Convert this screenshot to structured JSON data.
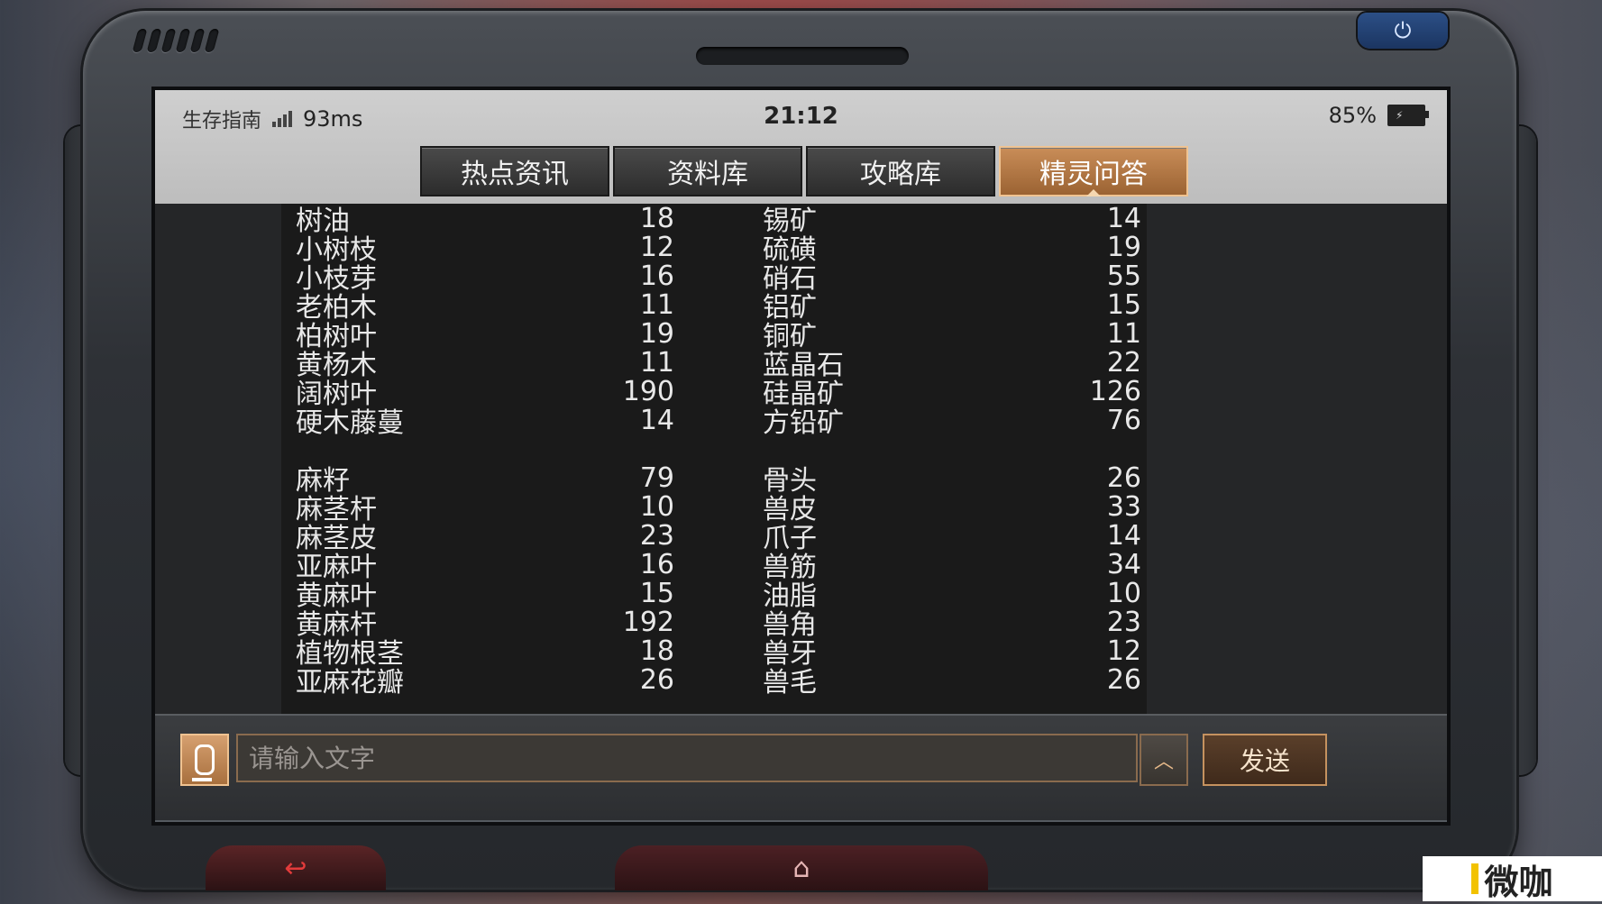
{
  "status": {
    "app_name": "生存指南",
    "ping": "93ms",
    "time": "21:12",
    "battery": "85%"
  },
  "tabs": [
    {
      "label": "热点资讯",
      "active": false
    },
    {
      "label": "资料库",
      "active": false
    },
    {
      "label": "攻略库",
      "active": false
    },
    {
      "label": "精灵问答",
      "active": true
    }
  ],
  "table": {
    "left_group1": [
      {
        "name": "树油",
        "value": "18"
      },
      {
        "name": "小树枝",
        "value": "12"
      },
      {
        "name": "小枝芽",
        "value": "16"
      },
      {
        "name": "老柏木",
        "value": "11"
      },
      {
        "name": "柏树叶",
        "value": "19"
      },
      {
        "name": "黄杨木",
        "value": "11"
      },
      {
        "name": "阔树叶",
        "value": "190"
      },
      {
        "name": "硬木藤蔓",
        "value": "14"
      }
    ],
    "left_group2": [
      {
        "name": "麻籽",
        "value": "79"
      },
      {
        "name": "麻茎杆",
        "value": "10"
      },
      {
        "name": "麻茎皮",
        "value": "23"
      },
      {
        "name": "亚麻叶",
        "value": "16"
      },
      {
        "name": "黄麻叶",
        "value": "15"
      },
      {
        "name": "黄麻杆",
        "value": "192"
      },
      {
        "name": "植物根茎",
        "value": "18"
      },
      {
        "name": "亚麻花瓣",
        "value": "26"
      }
    ],
    "right_group1": [
      {
        "name": "锡矿",
        "value": "14"
      },
      {
        "name": "硫磺",
        "value": "19"
      },
      {
        "name": "硝石",
        "value": "55"
      },
      {
        "name": "铝矿",
        "value": "15"
      },
      {
        "name": "铜矿",
        "value": "11"
      },
      {
        "name": "蓝晶石",
        "value": "22"
      },
      {
        "name": "硅晶矿",
        "value": "126"
      },
      {
        "name": "方铅矿",
        "value": "76"
      }
    ],
    "right_group2": [
      {
        "name": "骨头",
        "value": "26"
      },
      {
        "name": "兽皮",
        "value": "33"
      },
      {
        "name": "爪子",
        "value": "14"
      },
      {
        "name": "兽筋",
        "value": "34"
      },
      {
        "name": "油脂",
        "value": "10"
      },
      {
        "name": "兽角",
        "value": "23"
      },
      {
        "name": "兽牙",
        "value": "12"
      },
      {
        "name": "兽毛",
        "value": "26"
      }
    ]
  },
  "input": {
    "placeholder": "请输入文字",
    "send_label": "发送"
  },
  "icons": {
    "back": "back-arrow-icon",
    "home": "home-icon",
    "power": "power-icon",
    "mic": "mic-icon",
    "expand": "chevron-up-icon"
  },
  "watermark": "微咖"
}
